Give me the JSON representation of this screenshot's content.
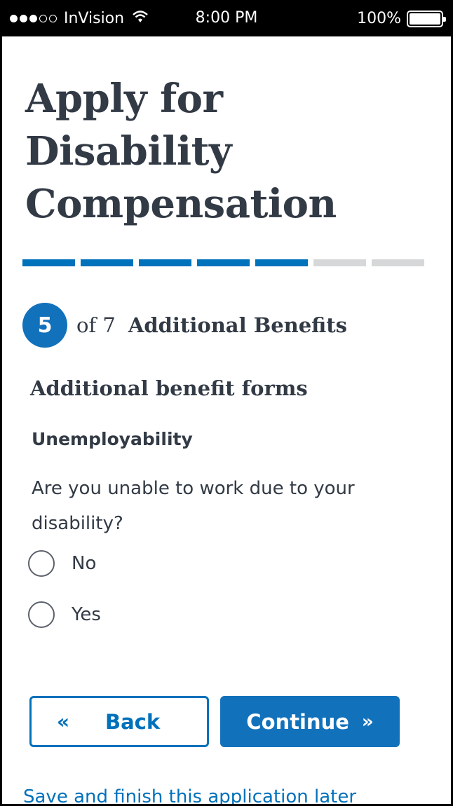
{
  "status_bar": {
    "carrier": "InVision",
    "time": "8:00 PM",
    "battery": "100%",
    "signal_dots_filled": 3,
    "signal_dots_total": 5
  },
  "page": {
    "title": "Apply for Disability Compensation"
  },
  "progress": {
    "completed_segments": 5,
    "total_segments": 7,
    "completed_color": "#0071bb",
    "remaining_color": "#d6d7d9"
  },
  "step": {
    "number": "5",
    "of_text": "of 7",
    "title": "Additional Benefits"
  },
  "form": {
    "section_title": "Additional benefit forms",
    "subsection_title": "Unemployability",
    "question": "Are you unable to work due to your disability?",
    "options": [
      {
        "label": "No",
        "selected": false
      },
      {
        "label": "Yes",
        "selected": false
      }
    ]
  },
  "buttons": {
    "back_label": "Back",
    "back_icon": "«",
    "continue_label": "Continue",
    "continue_icon": "»"
  },
  "links": {
    "save_later": "Save and finish this application later"
  },
  "colors": {
    "primary": "#0071bb",
    "text": "#323a45"
  }
}
